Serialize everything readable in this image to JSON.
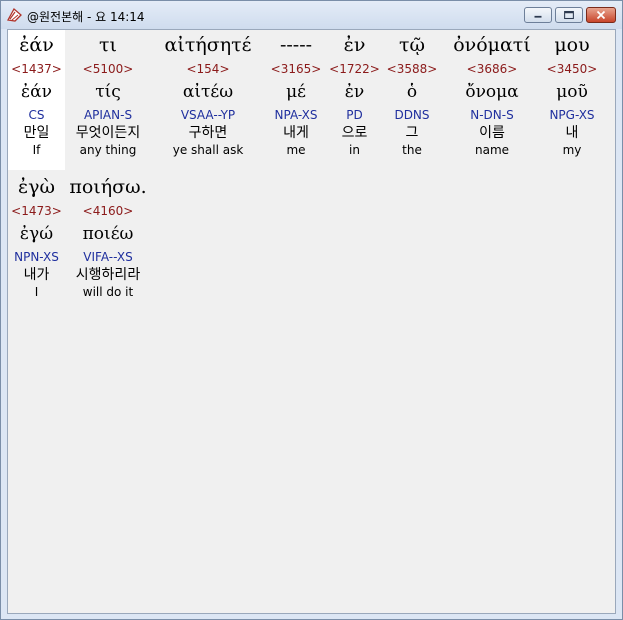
{
  "window": {
    "title": "@원전본해 - 요 14:14"
  },
  "rows": [
    [
      {
        "greek": "ἐάν",
        "strong": "<1437>",
        "lemma": "ἐάν",
        "morph": "CS",
        "korean": "만일",
        "english": "If"
      },
      {
        "greek": "τι",
        "strong": "<5100>",
        "lemma": "τίς",
        "morph": "APIAN-S",
        "korean": "무엇이든지",
        "english": "any thing"
      },
      {
        "greek": "αἰτήσητέ",
        "strong": "<154>",
        "lemma": "αἰτέω",
        "morph": "VSAA--YP",
        "korean": "구하면",
        "english": "ye shall ask"
      },
      {
        "greek": "-----",
        "strong": "<3165>",
        "lemma": "μέ",
        "morph": "NPA-XS",
        "korean": "내게",
        "english": "me"
      },
      {
        "greek": "ἐν",
        "strong": "<1722>",
        "lemma": "ἐν",
        "morph": "PD",
        "korean": "으로",
        "english": "in"
      },
      {
        "greek": "τῷ",
        "strong": "<3588>",
        "lemma": "ὁ",
        "morph": "DDNS",
        "korean": "그",
        "english": "the"
      },
      {
        "greek": "ὀνόματί",
        "strong": "<3686>",
        "lemma": "ὄνομα",
        "morph": "N-DN-S",
        "korean": "이름",
        "english": "name"
      },
      {
        "greek": "μου",
        "strong": "<3450>",
        "lemma": "μοῦ",
        "morph": "NPG-XS",
        "korean": "내",
        "english": "my"
      }
    ],
    [
      {
        "greek": "ἐγὼ",
        "strong": "<1473>",
        "lemma": "ἐγώ",
        "morph": "NPN-XS",
        "korean": "내가",
        "english": "I"
      },
      {
        "greek": "ποιήσω.",
        "strong": "<4160>",
        "lemma": "ποιέω",
        "morph": "VIFA--XS",
        "korean": "시행하리라",
        "english": "will do it"
      }
    ]
  ]
}
